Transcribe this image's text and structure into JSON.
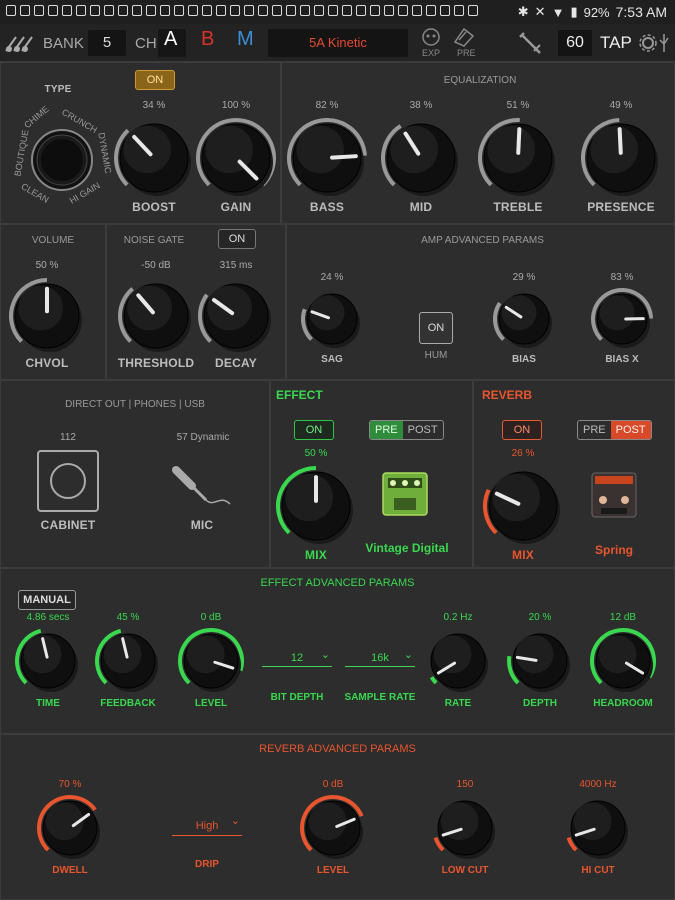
{
  "status_bar": {
    "battery": "92%",
    "time": "7:53 AM"
  },
  "top": {
    "bank_label": "BANK",
    "bank_value": "5",
    "ch_label": "CH",
    "ch_a": "A",
    "ch_b": "B",
    "ch_m": "M",
    "preset_name": "5A Kinetic",
    "exp_label": "EXP",
    "pre_label": "PRE",
    "tempo": "60",
    "tap_label": "TAP"
  },
  "colors": {
    "green": "#39d84f",
    "orange": "#e8552e",
    "on_gold": "#d09a2e",
    "ch_b": "#d8322a",
    "ch_m": "#3a8fd8"
  },
  "amp": {
    "type_label": "TYPE",
    "type_options": [
      "CHIME",
      "CRUNCH",
      "DYNAMIC",
      "HI GAIN",
      "CLEAN",
      "BOUTIQUE"
    ],
    "boost_on_label": "ON",
    "boost": {
      "label": "BOOST",
      "value": "34 %",
      "level": 0.34
    },
    "gain": {
      "label": "GAIN",
      "value": "100 %",
      "level": 1.0
    }
  },
  "eq": {
    "title": "EQUALIZATION",
    "bass": {
      "label": "BASS",
      "value": "82 %",
      "level": 0.82
    },
    "mid": {
      "label": "MID",
      "value": "38 %",
      "level": 0.38
    },
    "treble": {
      "label": "TREBLE",
      "value": "51 %",
      "level": 0.51
    },
    "presence": {
      "label": "PRESENCE",
      "value": "49 %",
      "level": 0.49
    }
  },
  "volume": {
    "title": "VOLUME",
    "chvol": {
      "label": "CHVOL",
      "value": "50 %",
      "level": 0.5
    }
  },
  "noise_gate": {
    "title": "NOISE GATE",
    "on_label": "ON",
    "threshold": {
      "label": "THRESHOLD",
      "value": "-50 dB",
      "level": 0.35
    },
    "decay": {
      "label": "DECAY",
      "value": "315 ms",
      "level": 0.3
    }
  },
  "amp_adv": {
    "title": "AMP ADVANCED PARAMS",
    "sag": {
      "label": "SAG",
      "value": "24 %",
      "level": 0.24
    },
    "hum_label": "HUM",
    "hum_btn": "ON",
    "bias": {
      "label": "BIAS",
      "value": "29 %",
      "level": 0.29
    },
    "biasx": {
      "label": "BIAS X",
      "value": "83 %",
      "level": 0.83
    }
  },
  "direct_out": {
    "title": "DIRECT OUT | PHONES | USB",
    "cabinet_value": "112",
    "cabinet_label": "CABINET",
    "mic_value": "57 Dynamic",
    "mic_label": "MIC"
  },
  "effect": {
    "title": "EFFECT",
    "on_label": "ON",
    "pre": "PRE",
    "post": "POST",
    "mix": {
      "label": "MIX",
      "value": "50 %",
      "level": 0.5
    },
    "name": "Vintage Digital"
  },
  "reverb": {
    "title": "REVERB",
    "on_label": "ON",
    "pre": "PRE",
    "post": "POST",
    "mix": {
      "label": "MIX",
      "value": "26 %",
      "level": 0.26
    },
    "name": "Spring"
  },
  "effect_adv": {
    "title": "EFFECT ADVANCED PARAMS",
    "manual": "MANUAL",
    "time": {
      "label": "TIME",
      "value": "4.86 secs",
      "level": 0.45
    },
    "feedback": {
      "label": "FEEDBACK",
      "value": "45 %",
      "level": 0.45
    },
    "level": {
      "label": "LEVEL",
      "value": "0 dB",
      "level": 0.9
    },
    "bit_depth": {
      "label": "BIT DEPTH",
      "value": "12"
    },
    "sample_rate": {
      "label": "SAMPLE RATE",
      "value": "16k"
    },
    "rate": {
      "label": "RATE",
      "value": "0.2 Hz",
      "level": 0.05
    },
    "depth": {
      "label": "DEPTH",
      "value": "20 %",
      "level": 0.2
    },
    "headroom": {
      "label": "HEADROOM",
      "value": "12 dB",
      "level": 0.95
    }
  },
  "reverb_adv": {
    "title": "REVERB ADVANCED PARAMS",
    "dwell": {
      "label": "DWELL",
      "value": "70 %",
      "level": 0.7
    },
    "drip": {
      "label": "DRIP",
      "value": "High"
    },
    "level": {
      "label": "LEVEL",
      "value": "0 dB",
      "level": 0.75
    },
    "low_cut": {
      "label": "LOW CUT",
      "value": "150",
      "level": 0.1
    },
    "hi_cut": {
      "label": "HI CUT",
      "value": "4000 Hz",
      "level": 0.1
    }
  }
}
